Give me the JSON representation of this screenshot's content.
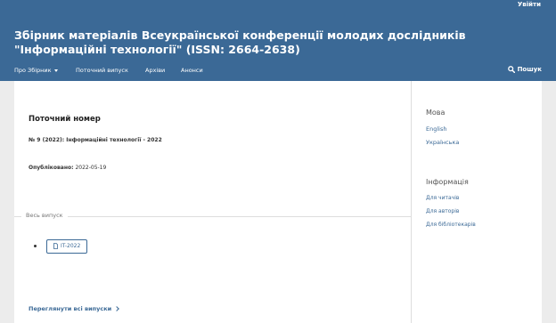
{
  "header": {
    "login": "Увійти",
    "title": "Збірник матеріалів Всеукраїнської конференції молодих дослідників \"Інформаційні технології\" (ISSN: 2664-2638)",
    "bg": "#3b6996"
  },
  "nav": {
    "about": "Про Збірник",
    "current": "Поточний випуск",
    "archives": "Архіви",
    "announcements": "Анонси",
    "search": "Пошук"
  },
  "main": {
    "heading": "Поточний номер",
    "issue_id": "№ 9 (2022): Інформаційні технології - 2022",
    "published_label": "Опубліковано:",
    "published_date": "2022-05-19",
    "full_issue_label": "Весь випуск",
    "galley_label": "IT-2022",
    "view_all": "Переглянути всі випуски"
  },
  "sidebar": {
    "language_heading": "Мова",
    "languages": [
      "English",
      "Українська"
    ],
    "info_heading": "Інформація",
    "info_links": [
      "Для читачів",
      "Для авторів",
      "Для бібліотекарів"
    ]
  }
}
